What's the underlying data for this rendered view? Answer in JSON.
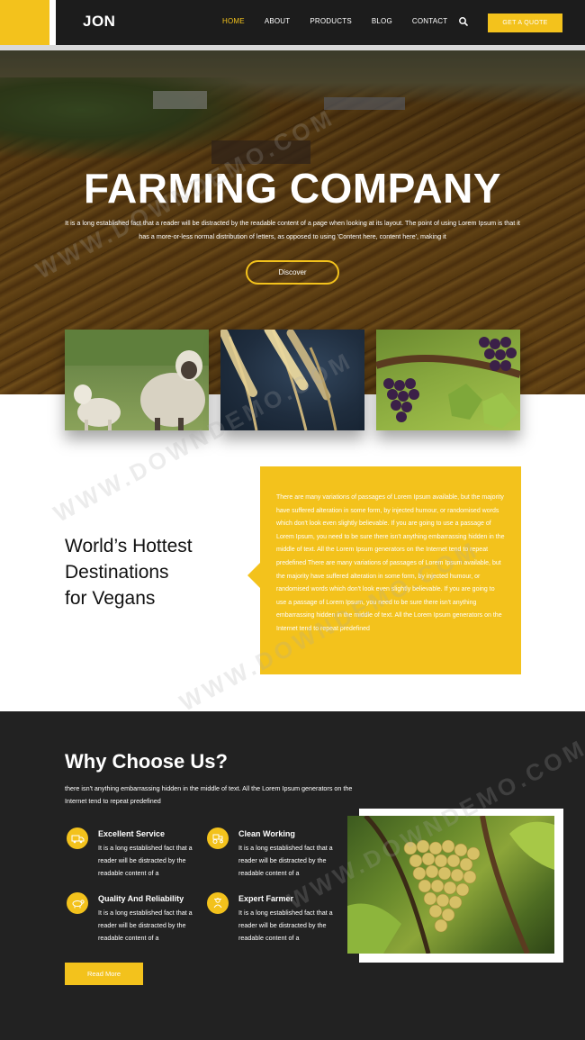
{
  "nav": {
    "logo": "JON",
    "items": [
      {
        "label": "HOME",
        "active": true
      },
      {
        "label": "ABOUT",
        "active": false
      },
      {
        "label": "PRODUCTS",
        "active": false
      },
      {
        "label": "BLOG",
        "active": false
      },
      {
        "label": "CONTACT",
        "active": false
      }
    ],
    "search_icon": "search-icon",
    "quote_button": "GET A QUOTE"
  },
  "hero": {
    "title": "FARMING COMPANY",
    "text": "It is a long established fact that a reader will be distracted by the readable content of a page when looking at its layout. The point of using Lorem Ipsum is that it has a more-or-less normal distribution of letters, as opposed to using 'Content here, content here', making it",
    "button": "Discover"
  },
  "gallery": {
    "images": [
      "sheep",
      "wheat",
      "grapes"
    ]
  },
  "destinations": {
    "title_lines": [
      "World’s Hottest",
      "Destinations",
      "for Vegans"
    ],
    "body": "There are many variations of passages of Lorem Ipsum available, but the majority have suffered alteration in some form, by injected humour, or randomised words which don't look even slightly believable. If you are going to use a passage of Lorem Ipsum, you need to be sure there isn't anything embarrassing hidden in the middle of text. All the Lorem Ipsum generators on the Internet tend to repeat predefined There are many variations of passages of Lorem Ipsum available, but the majority have suffered alteration in some form, by injected humour, or randomised words which don't look even slightly believable. If you are going to use a passage of Lorem Ipsum, you need to be sure there isn't anything embarrassing hidden in the middle of text. All the Lorem Ipsum generators on the Internet tend to repeat predefined"
  },
  "why": {
    "title": "Why Choose Us?",
    "text": "there isn't anything embarrassing hidden in the middle of text. All the Lorem Ipsum generators on the Internet tend to repeat predefined",
    "features": [
      {
        "title": "Excellent Service",
        "text": "It is a long established fact that a reader will be distracted by the readable content of a",
        "icon": "truck-icon"
      },
      {
        "title": "Clean Working",
        "text": "It is a long established fact that a reader will be distracted by the readable content of a",
        "icon": "tractor-icon"
      },
      {
        "title": "Quality And Reliability",
        "text": "It is a long established fact that a reader will be distracted by the readable content of a",
        "icon": "cow-icon"
      },
      {
        "title": "Expert Farmer",
        "text": "It is a long established fact that a reader will be distracted by the readable content of a",
        "icon": "farmer-icon"
      }
    ],
    "button": "Read More"
  },
  "watermark": "WWW.DOWNDEMO.COM",
  "colors": {
    "accent": "#f3c21c",
    "dark": "#222222",
    "nav_dark": "#1c1c1c"
  }
}
